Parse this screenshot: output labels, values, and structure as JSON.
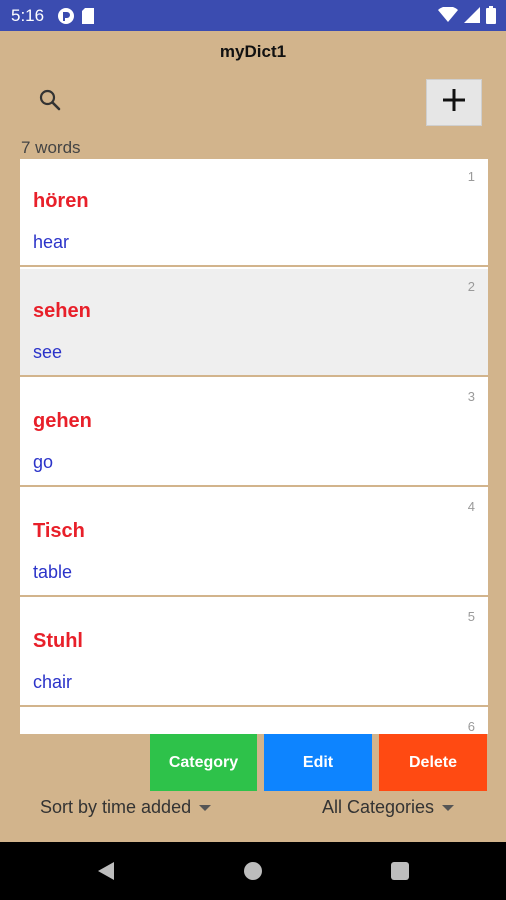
{
  "status": {
    "time": "5:16"
  },
  "app": {
    "title": "myDict1"
  },
  "word_count": "7 words",
  "words": [
    {
      "index": "1",
      "word": "hören",
      "meaning": "hear"
    },
    {
      "index": "2",
      "word": "sehen",
      "meaning": "see"
    },
    {
      "index": "3",
      "word": "gehen",
      "meaning": "go"
    },
    {
      "index": "4",
      "word": "Tisch",
      "meaning": "table"
    },
    {
      "index": "5",
      "word": "Stuhl",
      "meaning": "chair"
    },
    {
      "index": "6",
      "word": "",
      "meaning": ""
    }
  ],
  "actions": {
    "category": "Category",
    "edit": "Edit",
    "delete": "Delete"
  },
  "sort": {
    "selected": "Sort by time added"
  },
  "filter": {
    "selected": "All Categories"
  },
  "colors": {
    "word": "#e8202a",
    "meaning": "#2b33c9",
    "category_btn": "#2ec24a",
    "edit_btn": "#0d84ff",
    "delete_btn": "#ff4a12",
    "background": "#d2b48c"
  }
}
